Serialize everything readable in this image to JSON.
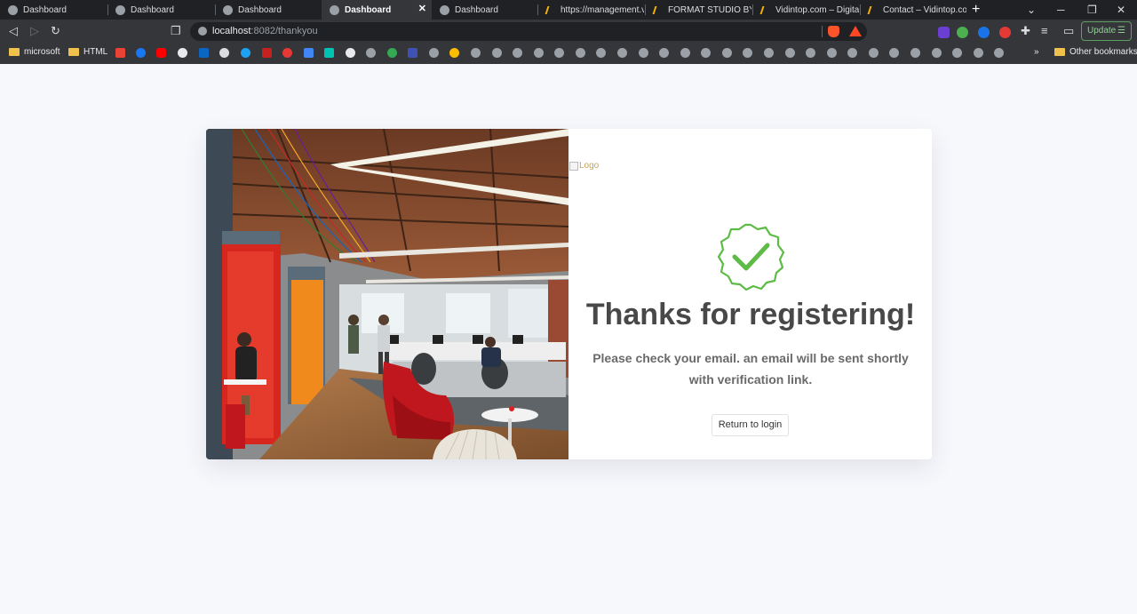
{
  "browser": {
    "tabs": [
      {
        "title": "Dashboard",
        "icon": "globe-icon"
      },
      {
        "title": "Dashboard",
        "icon": "globe-icon"
      },
      {
        "title": "Dashboard",
        "icon": "globe-icon"
      },
      {
        "title": "Dashboard",
        "icon": "globe-icon",
        "active": true
      },
      {
        "title": "Dashboard",
        "icon": "globe-icon"
      },
      {
        "title": "https://management.vic",
        "icon": "vidintop-icon"
      },
      {
        "title": "FORMAT STUDIO BY VID",
        "icon": "vidintop-icon"
      },
      {
        "title": "Vidintop.com – Digital a",
        "icon": "vidintop-icon"
      },
      {
        "title": "Contact – Vidintop.com",
        "icon": "vidintop-icon"
      }
    ],
    "tab_close": "✕",
    "new_tab": "+",
    "window_controls": {
      "minimize": "─",
      "restore": "❐",
      "close": "✕",
      "tab_search": "⌄"
    },
    "url_host": "localhost",
    "url_rest": ":8082/thankyou",
    "update_label": "Update",
    "bookmarks": {
      "microsoft": "microsoft",
      "html": "HTML",
      "more": "»",
      "other": "Other bookmarks"
    }
  },
  "page": {
    "logo_alt": "Logo",
    "title": "Thanks for registering!",
    "message": "Please check your email. an email will be sent shortly with verification link.",
    "return_button": "Return to login"
  },
  "colors": {
    "accent_green": "#5dbb46",
    "title_gray": "#484848",
    "page_bg": "#f7f8fc"
  }
}
